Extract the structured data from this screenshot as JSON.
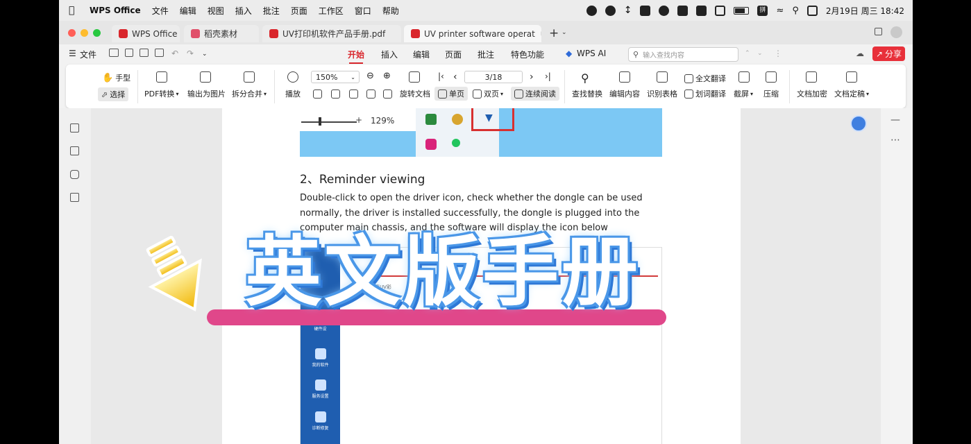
{
  "menubar": {
    "app_name": "WPS Office",
    "items": [
      "文件",
      "编辑",
      "视图",
      "插入",
      "批注",
      "页面",
      "工作区",
      "窗口",
      "帮助"
    ],
    "ime": "拼",
    "datetime": "2月19日 周三 18:42"
  },
  "tabs": [
    {
      "label": "WPS Office",
      "icon_color": "#d9262c"
    },
    {
      "label": "稻壳素材",
      "icon_color": "#e0506a"
    },
    {
      "label": "UV打印机软件产品手册.pdf",
      "icon_color": "#d9262c"
    },
    {
      "label": "UV printer software operat",
      "icon_color": "#d9262c"
    }
  ],
  "ribbon": {
    "file": "文件",
    "tabs": [
      "开始",
      "插入",
      "编辑",
      "页面",
      "批注",
      "特色功能"
    ],
    "active_tab": "开始",
    "wps_ai": "WPS AI",
    "search_placeholder": "输入查找内容",
    "share": "分享"
  },
  "toolbar": {
    "hand": "手型",
    "select": "选择",
    "pdf_convert": "PDF转换",
    "export_image": "输出为图片",
    "split_merge": "拆分合并",
    "play": "播放",
    "zoom": "150%",
    "rotate": "旋转文档",
    "page": "3/18",
    "single_page": "单页",
    "double_page": "双页",
    "continuous": "连续阅读",
    "find_replace": "查找替换",
    "edit_content": "编辑内容",
    "recognize_table": "识别表格",
    "full_translate": "全文翻译",
    "word_translate": "划词翻译",
    "screenshot": "截屏",
    "compress": "压缩",
    "encrypt": "文档加密",
    "finalize": "文档定稿"
  },
  "document": {
    "zoom_readout": "129%",
    "heading": "2、Reminder viewing",
    "paragraph": "Double-click to open the driver icon, check whether the dongle can be used normally, the driver is installed successfully, the dongle is plugged into the computer main chassis, and the software will display the icon below",
    "sidebar_items": [
      "硬件设",
      "我的软件",
      "服务设置",
      "诊断修复"
    ],
    "tiny_text": "力嘉UV彩"
  },
  "overlay": {
    "title": "英文版手册",
    "bar_color": "#e0478a",
    "title_glow": "#4a97e8"
  },
  "colors": {
    "accent": "#d9262c"
  }
}
